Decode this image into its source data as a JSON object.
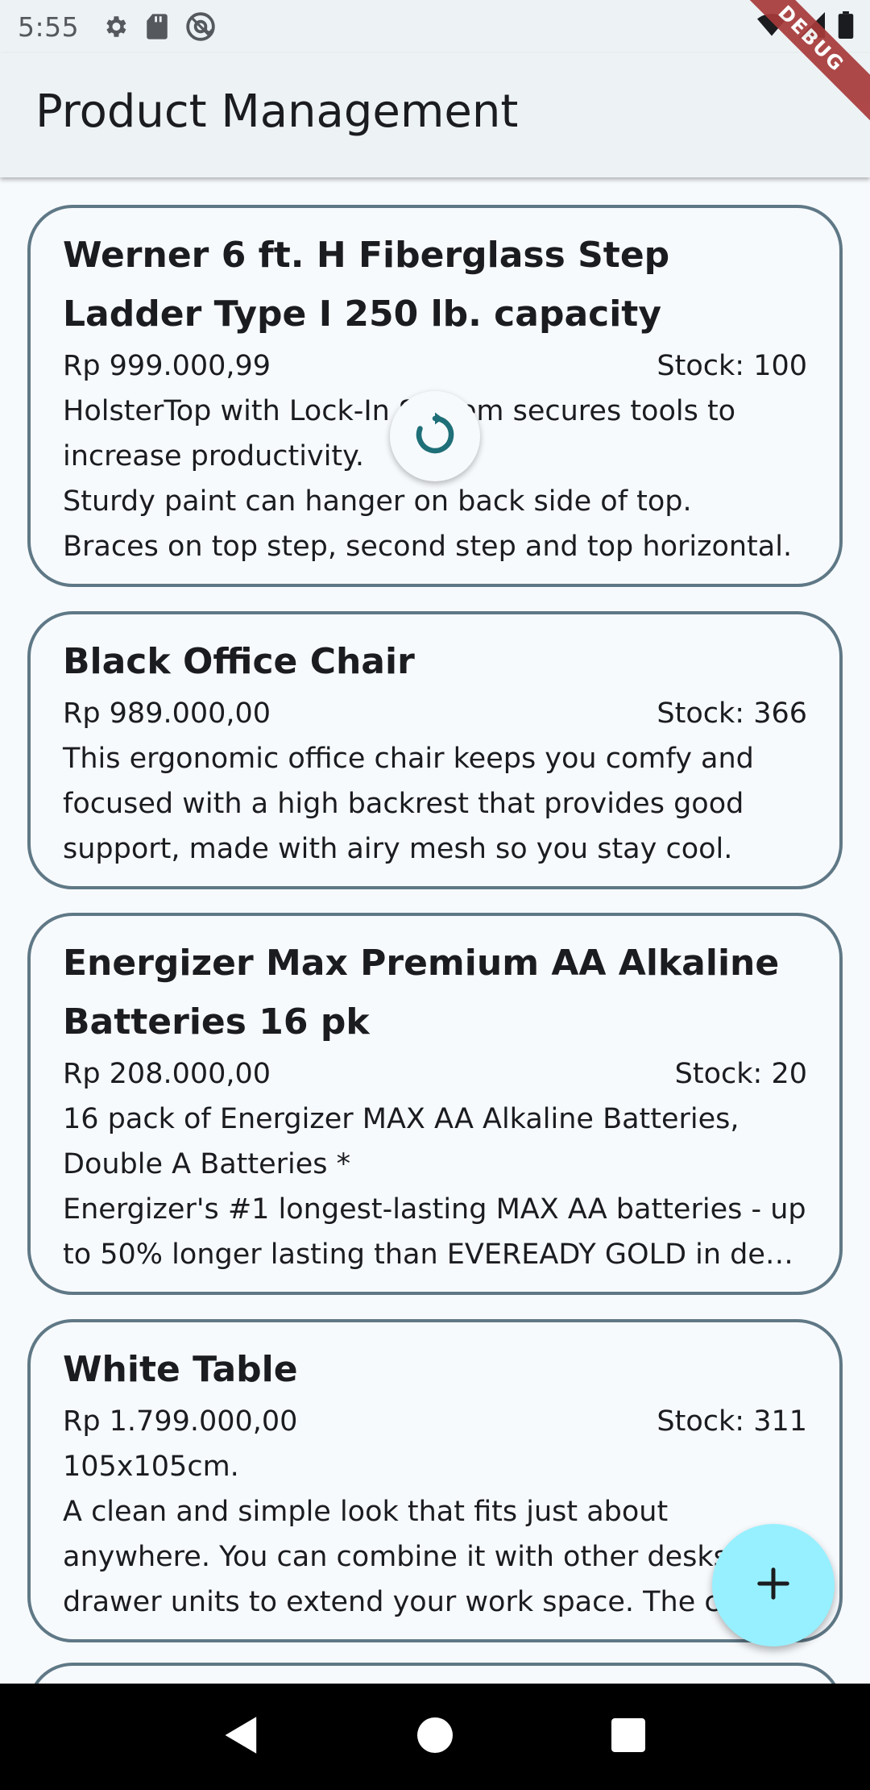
{
  "status_bar": {
    "time": "5:55",
    "left_icons": [
      "gear-icon",
      "sd-card-icon",
      "at-sign-icon"
    ],
    "right_icons": [
      "wifi-icon",
      "signal-icon",
      "battery-icon"
    ]
  },
  "debug_banner": "DEBUG",
  "app_bar": {
    "title": "Product Management"
  },
  "products": [
    {
      "name": "Werner 6 ft. H Fiberglass Step Ladder Type I 250 lb. capacity",
      "price": "Rp 999.000,99",
      "stock": "Stock: 100",
      "description": "HolsterTop with Lock-In System secures tools to increase productivity.\nSturdy paint can hanger on back side of top.\nBraces on top step, second step and top horizontal."
    },
    {
      "name": "Black Office Chair",
      "price": "Rp 989.000,00",
      "stock": "Stock: 366",
      "description": "This ergonomic office chair keeps you comfy and focused with a high backrest that provides good support, made with airy mesh so you stay cool."
    },
    {
      "name": "Energizer Max Premium AA Alkaline Batteries 16 pk",
      "price": "Rp 208.000,00",
      "stock": "Stock: 20",
      "description": "16 pack of Energizer MAX AA Alkaline Batteries, Double A Batteries *\nEnergizer's #1 longest-lasting MAX AA batteries - up to 50% longer lasting than EVEREADY GOLD in de…"
    },
    {
      "name": "White Table",
      "price": "Rp 1.799.000,00",
      "stock": "Stock: 311",
      "description": "105x105cm.\nA clean and simple look that fits just about anywhere. You can combine it with other desks or drawer units to extend your work space. The c"
    }
  ],
  "fab": {
    "icon": "plus-icon"
  },
  "colors": {
    "card_border": "#5f7886",
    "app_bar_bg": "#edf2f5",
    "fab_bg": "#97f0ff",
    "refresh_accent": "#1f6f78",
    "debug_ribbon": "#a83a3a"
  },
  "nav_bar": {
    "icons": [
      "back-icon",
      "home-icon",
      "recents-icon"
    ]
  }
}
